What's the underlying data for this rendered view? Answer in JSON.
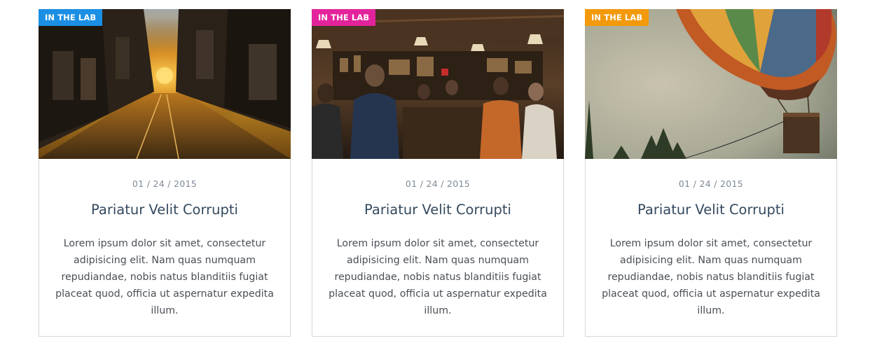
{
  "cards": [
    {
      "badge": "IN THE LAB",
      "badge_color": "#1a8fe3",
      "image": "sunset-city-street-photo",
      "date": "01 / 24 / 2015",
      "title": "Pariatur Velit Corrupti",
      "text": "Lorem ipsum dolor sit amet, consectetur adipisicing elit. Nam quas numquam repudiandae, nobis natus blanditiis fugiat placeat quod, officia ut aspernatur expedita illum."
    },
    {
      "badge": "IN THE LAB",
      "badge_color": "#e3239b",
      "image": "crowded-cafe-bar-photo",
      "date": "01 / 24 / 2015",
      "title": "Pariatur Velit Corrupti",
      "text": "Lorem ipsum dolor sit amet, consectetur adipisicing elit. Nam quas numquam repudiandae, nobis natus blanditiis fugiat placeat quod, officia ut aspernatur expedita illum."
    },
    {
      "badge": "IN THE LAB",
      "badge_color": "#f2990c",
      "image": "hot-air-balloon-photo",
      "date": "01 / 24 / 2015",
      "title": "Pariatur Velit Corrupti",
      "text": "Lorem ipsum dolor sit amet, consectetur adipisicing elit. Nam quas numquam repudiandae, nobis natus blanditiis fugiat placeat quod, officia ut aspernatur expedita illum."
    }
  ]
}
